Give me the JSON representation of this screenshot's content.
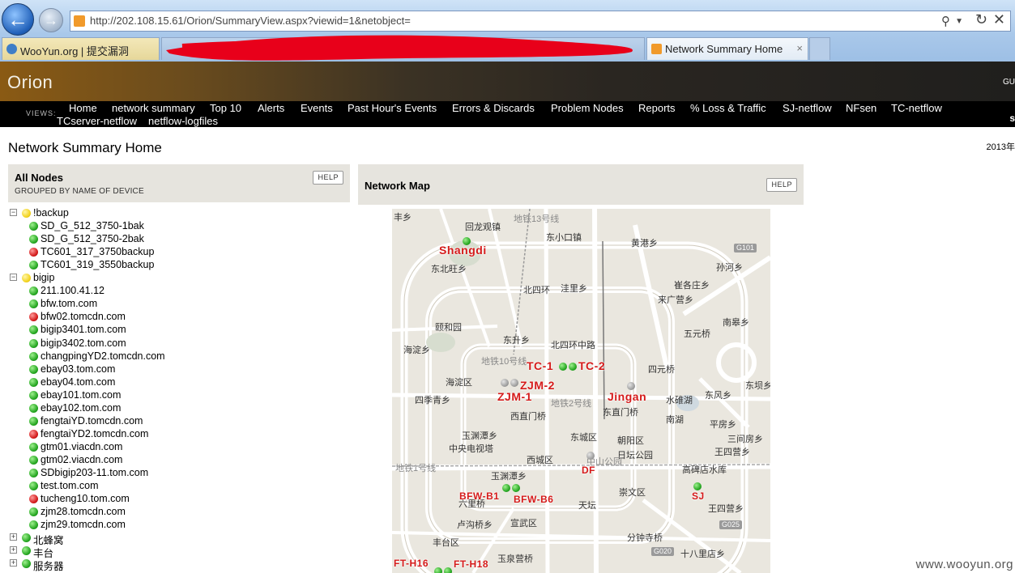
{
  "browser": {
    "url": "http://202.108.15.61/Orion/SummaryView.aspx?viewid=1&netobject=",
    "tabs": [
      {
        "label": "WooYun.org | 提交漏洞"
      },
      {
        "label": "Network Summary Home",
        "close": "×"
      }
    ]
  },
  "header": {
    "logo": "Orion",
    "right_text": "GU"
  },
  "nav": {
    "views_label": "VIEWS:",
    "items": [
      "Home",
      "network summary",
      "Top 10",
      "Alerts",
      "Events",
      "Past Hour's Events",
      "Errors & Discards",
      "Problem Nodes",
      "Reports",
      "% Loss & Traffic",
      "SJ-netflow",
      "NFsen",
      "TC-netflow",
      "TCserver-netflow",
      "netflow-logfiles"
    ],
    "right_text": "s"
  },
  "page": {
    "title": "Network Summary Home",
    "date": "2013年"
  },
  "all_nodes": {
    "title": "All Nodes",
    "subtitle": "GROUPED BY NAME OF DEVICE",
    "help": "HELP",
    "groups": [
      {
        "name": "!backup",
        "expanded": true,
        "status": "yellow",
        "children": [
          {
            "name": "SD_G_512_3750-1bak",
            "status": "green"
          },
          {
            "name": "SD_G_512_3750-2bak",
            "status": "green"
          },
          {
            "name": "TC601_317_3750backup",
            "status": "red"
          },
          {
            "name": "TC601_319_3550backup",
            "status": "green"
          }
        ]
      },
      {
        "name": "bigip",
        "expanded": true,
        "status": "yellow",
        "children": [
          {
            "name": "211.100.41.12",
            "status": "green"
          },
          {
            "name": "bfw.tom.com",
            "status": "green"
          },
          {
            "name": "bfw02.tomcdn.com",
            "status": "red"
          },
          {
            "name": "bigip3401.tom.com",
            "status": "green"
          },
          {
            "name": "bigip3402.tom.com",
            "status": "green"
          },
          {
            "name": "changpingYD2.tomcdn.com",
            "status": "green"
          },
          {
            "name": "ebay03.tom.com",
            "status": "green"
          },
          {
            "name": "ebay04.tom.com",
            "status": "green"
          },
          {
            "name": "ebay101.tom.com",
            "status": "green"
          },
          {
            "name": "ebay102.tom.com",
            "status": "green"
          },
          {
            "name": "fengtaiYD.tomcdn.com",
            "status": "green"
          },
          {
            "name": "fengtaiYD2.tomcdn.com",
            "status": "red"
          },
          {
            "name": "gtm01.viacdn.com",
            "status": "green"
          },
          {
            "name": "gtm02.viacdn.com",
            "status": "green"
          },
          {
            "name": "SDbigip203-11.tom.com",
            "status": "green"
          },
          {
            "name": "test.tom.com",
            "status": "green"
          },
          {
            "name": "tucheng10.tom.com",
            "status": "red"
          },
          {
            "name": "zjm28.tomcdn.com",
            "status": "green"
          },
          {
            "name": "zjm29.tomcdn.com",
            "status": "green"
          }
        ]
      },
      {
        "name": "北蜂窝",
        "expanded": false,
        "status": "green",
        "children": []
      },
      {
        "name": "丰台",
        "expanded": false,
        "status": "green",
        "children": []
      },
      {
        "name": "服务器",
        "expanded": false,
        "status": "green",
        "children": []
      }
    ]
  },
  "network_map": {
    "title": "Network Map",
    "help": "HELP",
    "nodes": [
      {
        "label": "Shangdi",
        "status": "green"
      },
      {
        "label": "TC-1",
        "status": "green"
      },
      {
        "label": "TC-2",
        "status": "green"
      },
      {
        "label": "ZJM-2",
        "status": "gray"
      },
      {
        "label": "ZJM-1",
        "status": "gray"
      },
      {
        "label": "Jingan",
        "status": "gray"
      },
      {
        "label": "DF",
        "status": "gray"
      },
      {
        "label": "BFW-B1",
        "status": "green"
      },
      {
        "label": "BFW-B6",
        "status": "green"
      },
      {
        "label": "SJ",
        "status": "green"
      },
      {
        "label": "FT-H16",
        "status": "green"
      },
      {
        "label": "FT-H18",
        "status": "green"
      }
    ],
    "places": [
      "丰乡",
      "回龙观镇",
      "东小口镇",
      "黄港乡",
      "东北旺乡",
      "孙河乡",
      "北四环",
      "洼里乡",
      "崔各庄乡",
      "来广营乡",
      "南皋乡",
      "颐和园",
      "东升乡",
      "五元桥",
      "海淀乡",
      "北四环中路",
      "四元桥",
      "海淀区",
      "东坝乡",
      "四季青乡",
      "水碓湖",
      "东风乡",
      "西直门桥",
      "东直门桥",
      "南湖",
      "平房乡",
      "玉渊潭乡",
      "东城区",
      "三间房乡",
      "中央电视塔",
      "朝阳区",
      "王四营乡",
      "西城区",
      "日坛公园",
      "高碑店水库",
      "玉渊潭乡",
      "六里桥",
      "崇文区",
      "天坛",
      "王四营乡",
      "卢沟桥乡",
      "宣武区",
      "丰台区",
      "分钟寺桥",
      "玉泉营桥",
      "十八里店乡",
      "地铁1号线",
      "地铁2号线",
      "地铁10号线",
      "地铁13号线",
      "中山公园"
    ],
    "shields": [
      "G101",
      "G025",
      "G020"
    ]
  },
  "watermark": "www.wooyun.org"
}
